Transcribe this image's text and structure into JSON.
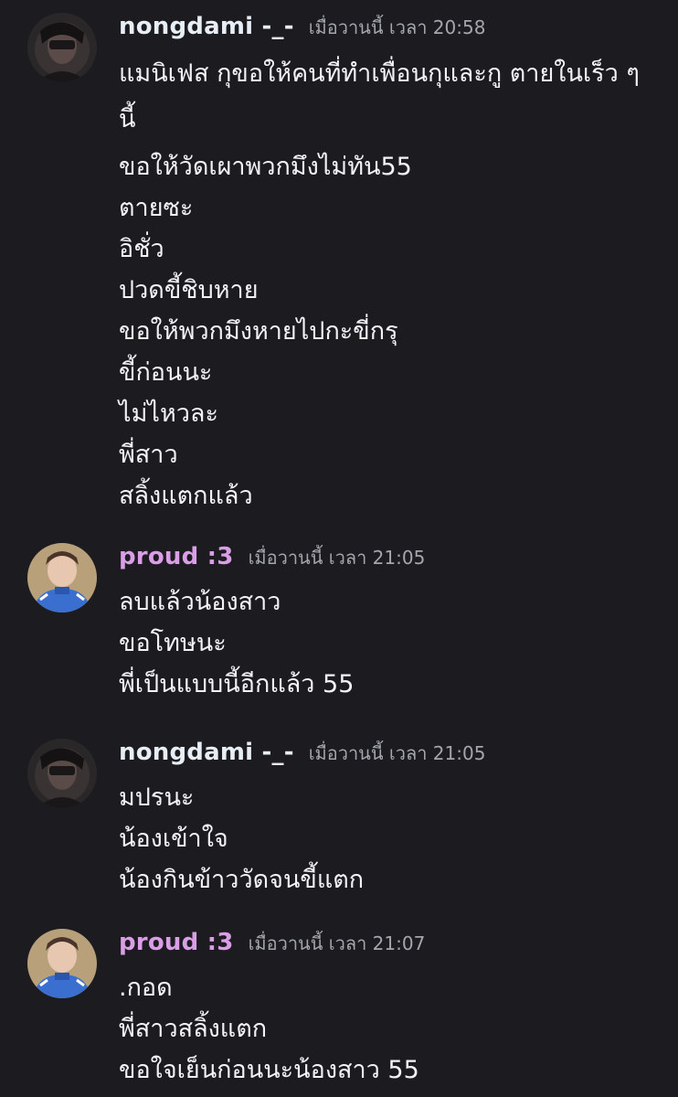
{
  "messages": [
    {
      "username": "nongdami -_-",
      "timestamp": "เมื่อวานนี้ เวลา 20:58",
      "lines": [
        "แมนิเฟส กุขอให้คนที่ทำเพื่อนกุและกู ตายในเร็ว ๆ นี้",
        "ขอให้วัดเผาพวกมึงไม่ทัน55",
        "ตายซะ",
        "อิชั่ว",
        "ปวดขี้ชิบหาย",
        "ขอให้พวกมึงหายไปกะขี่กรุ",
        "ขี้ก่อนนะ",
        "ไม่ไหวละ",
        "พี่สาว",
        "สลิ้งแตกแล้ว"
      ]
    },
    {
      "username": "proud :3",
      "timestamp": "เมื่อวานนี้ เวลา 21:05",
      "lines": [
        "ลบแล้วน้องสาว",
        "ขอโทษนะ",
        "พี่เป็นแบบนี้อีกแล้ว 55"
      ]
    },
    {
      "username": "nongdami -_-",
      "timestamp": "เมื่อวานนี้ เวลา 21:05",
      "lines": [
        "มปรนะ",
        "น้องเข้าใจ",
        "น้องกินข้าววัดจนขี้แตก"
      ]
    },
    {
      "username": "proud :3",
      "timestamp": "เมื่อวานนี้ เวลา 21:07",
      "lines": [
        ".กอด",
        "พี่สาวสลิ้งแตก",
        "ขอใจเย็นก่อนนะน้องสาว 55"
      ]
    }
  ],
  "colors": {
    "background": "#1c1c20",
    "username_nongdami": "#e8eef5",
    "username_proud": "#d99ee6",
    "timestamp": "#a3a6ad",
    "text": "#f2f3f5"
  },
  "icons": {
    "nongdami_avatar": "dark-selfie-avatar",
    "proud_avatar": "blue-jacket-selfie-avatar"
  }
}
